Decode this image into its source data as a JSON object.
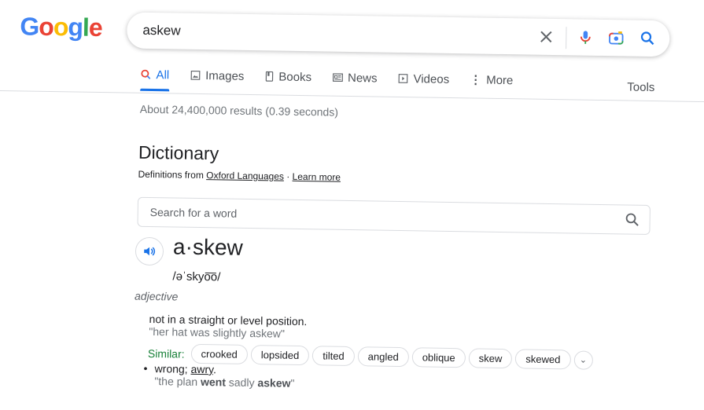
{
  "logo": {
    "letters": [
      "G",
      "o",
      "o",
      "g",
      "l",
      "e"
    ],
    "colors": [
      "#4285f4",
      "#ea4335",
      "#fbbc05",
      "#4285f4",
      "#34a853",
      "#ea4335"
    ]
  },
  "search": {
    "query": "askew",
    "icons": [
      "clear-icon",
      "mic-icon",
      "camera-lens-icon",
      "search-icon"
    ]
  },
  "tabs": [
    {
      "label": "All",
      "icon": "search-icon",
      "active": true
    },
    {
      "label": "Images",
      "icon": "image-icon"
    },
    {
      "label": "Books",
      "icon": "book-icon"
    },
    {
      "label": "News",
      "icon": "news-icon"
    },
    {
      "label": "Videos",
      "icon": "video-icon"
    },
    {
      "label": "More",
      "icon": "more-vert-icon"
    }
  ],
  "tools_label": "Tools",
  "stats": "About 24,400,000 results (0.39 seconds)",
  "dictionary": {
    "title": "Dictionary",
    "source_prefix": "Definitions from ",
    "source": "Oxford Languages",
    "sep": " · ",
    "learn_more": "Learn more",
    "word_search_placeholder": "Search for a word",
    "headword": "a·skew",
    "pronunciation": "/əˈskyo͞o/",
    "part_of_speech": "adjective",
    "def1": "not in a straight or level position.",
    "ex1": "\"her hat was slightly askew\"",
    "similar_label": "Similar:",
    "similar": [
      "crooked",
      "lopsided",
      "tilted",
      "angled",
      "oblique",
      "skew",
      "skewed"
    ],
    "def2_prefix": "wrong; ",
    "def2_link": "awry",
    "def2_suffix": ".",
    "ex2": {
      "a": "\"the plan ",
      "b": "went",
      "c": " sadly ",
      "d": "askew",
      "e": "\""
    }
  },
  "accent": "#1a73e8"
}
